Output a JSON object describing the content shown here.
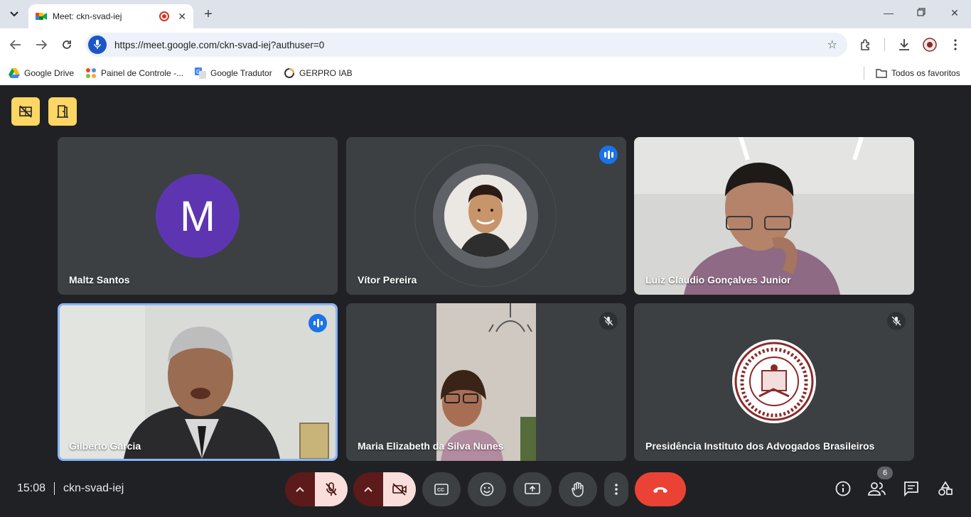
{
  "browser": {
    "tab_title": "Meet: ckn-svad-iej",
    "url": "https://meet.google.com/ckn-svad-iej?authuser=0",
    "bookmarks": [
      {
        "label": "Google Drive",
        "icon": "google-drive-icon"
      },
      {
        "label": "Painel de Controle -...",
        "icon": "joomla-icon"
      },
      {
        "label": "Google Tradutor",
        "icon": "google-translate-icon"
      },
      {
        "label": "GERPRO IAB",
        "icon": "gerpro-icon"
      }
    ],
    "all_bookmarks_label": "Todos os favoritos"
  },
  "meet": {
    "tiles": [
      {
        "name": "Maltz Santos",
        "avatar_letter": "M",
        "avatar_color": "#5e35b1",
        "state": "avatar"
      },
      {
        "name": "Vítor Pereira",
        "state": "speaking-avatar"
      },
      {
        "name": "Luiz Claudio Gonçalves Junior",
        "state": "video"
      },
      {
        "name": "Gilberto Garcia",
        "state": "video-speaking"
      },
      {
        "name": "Maria Elizabeth da Silva Nunes",
        "state": "video-muted"
      },
      {
        "name": "Presidência Instituto dos Advogados Brasileiros",
        "state": "logo-muted"
      }
    ],
    "controls": {
      "time": "15:08",
      "meeting_code": "ckn-svad-iej",
      "participants_count": "6"
    },
    "colors": {
      "background": "#202124",
      "tile": "#3c4043",
      "accent": "#1a73e8",
      "leave": "#ea4335",
      "host_controls": "#fdd663"
    }
  }
}
